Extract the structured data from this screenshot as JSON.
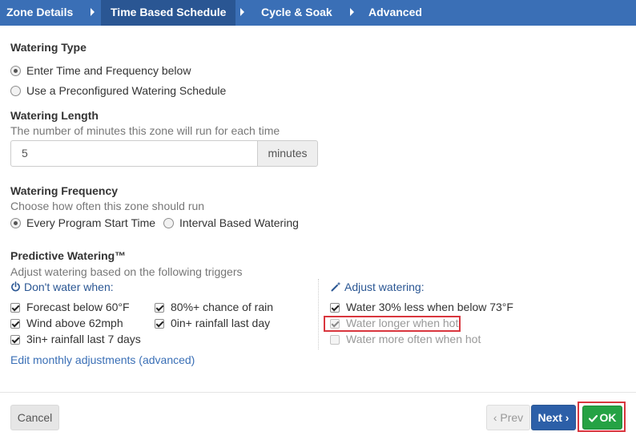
{
  "tabs": [
    {
      "label": "Zone Details"
    },
    {
      "label": "Time Based Schedule"
    },
    {
      "label": "Cycle & Soak"
    },
    {
      "label": "Advanced"
    }
  ],
  "watering_type": {
    "heading": "Watering Type",
    "options": [
      "Enter Time and Frequency below",
      "Use a Preconfigured Watering Schedule"
    ],
    "selected": "Enter Time and Frequency below"
  },
  "watering_length": {
    "heading": "Watering Length",
    "help": "The number of minutes this zone will run for each time",
    "value": "5",
    "unit": "minutes"
  },
  "watering_frequency": {
    "heading": "Watering Frequency",
    "help": "Choose how often this zone should run",
    "options": [
      "Every Program Start Time",
      "Interval Based Watering"
    ],
    "selected": "Every Program Start Time"
  },
  "predictive": {
    "heading": "Predictive Watering™",
    "help": "Adjust watering based on the following triggers",
    "dont_water_label": "Don't water when:",
    "dont_water_items": [
      {
        "label": "Forecast below 60°F",
        "checked": true
      },
      {
        "label": "80%+ chance of rain",
        "checked": true
      },
      {
        "label": "Wind above 62mph",
        "checked": true
      },
      {
        "label": "0in+ rainfall last day",
        "checked": true
      },
      {
        "label": "3in+ rainfall last 7 days",
        "checked": true
      }
    ],
    "adjust_label": "Adjust watering:",
    "adjust_items": [
      {
        "label": "Water 30% less when below 73°F",
        "checked": true
      },
      {
        "label": "Water longer when hot",
        "checked": true
      },
      {
        "label": "Water more often when hot",
        "checked": false
      }
    ],
    "edit_link": "Edit monthly adjustments (advanced)"
  },
  "footer": {
    "cancel": "Cancel",
    "prev": "‹ Prev",
    "next": "Next ›",
    "ok": "OK"
  },
  "icons": {
    "power": "power-icon",
    "wand": "magic-wand-icon",
    "check": "checkmark-icon"
  },
  "colors": {
    "tab_bar": "#3a6fb6",
    "tab_active": "#2a5693",
    "link": "#3a6fb6",
    "next_button": "#2c5fa8",
    "ok_button": "#25a244",
    "highlight": "#d9363e"
  }
}
